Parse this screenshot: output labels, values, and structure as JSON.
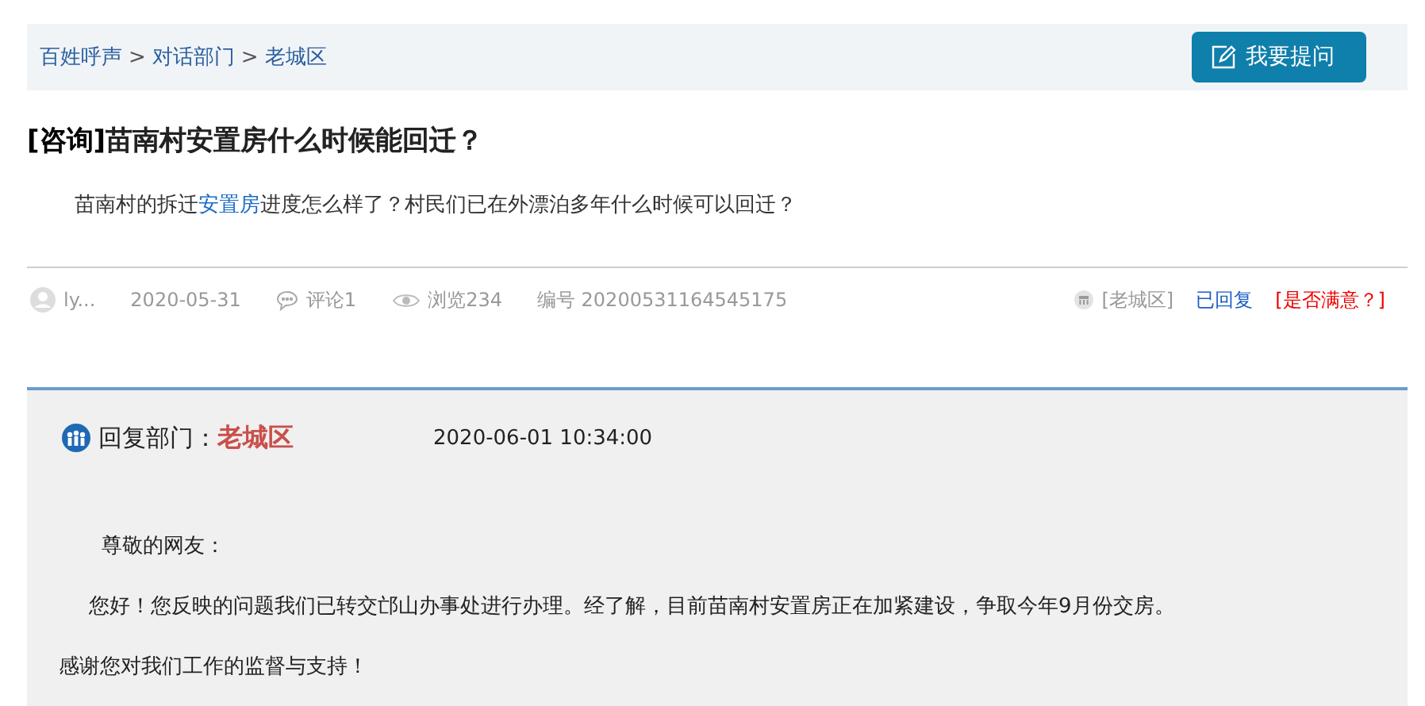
{
  "breadcrumb": {
    "items": [
      "百姓呼声",
      "对话部门",
      "老城区"
    ],
    "separator": ">"
  },
  "ask_button": {
    "label": "我要提问"
  },
  "question": {
    "tag": "[咨询]",
    "title": "苗南村安置房什么时候能回迁？",
    "body": [
      {
        "kind": "text",
        "text": "苗南村的拆迁"
      },
      {
        "kind": "link",
        "text": "安置房"
      },
      {
        "kind": "text",
        "text": "进度怎么样了？村民们已在外漂泊多年什么时候可以回迁？"
      }
    ]
  },
  "meta": {
    "author": "ly...",
    "date": "2020-05-31",
    "comments": "评论1",
    "views": "浏览234",
    "number": "编号 20200531164545175",
    "department": "[老城区]",
    "status": "已回复",
    "satisfaction": "[是否满意？]"
  },
  "reply": {
    "label": "回复部门：",
    "department": "老城区",
    "time": "2020-06-01 10:34:00",
    "paragraphs": [
      {
        "kind": "salutation",
        "text": "尊敬的网友："
      },
      {
        "kind": "body",
        "text": "您好！您反映的问题我们已转交邙山办事处进行办理。经了解，目前苗南村安置房正在加紧建设，争取今年9月份交房。"
      },
      {
        "kind": "closing",
        "text": "感谢您对我们工作的监督与支持！"
      }
    ]
  }
}
